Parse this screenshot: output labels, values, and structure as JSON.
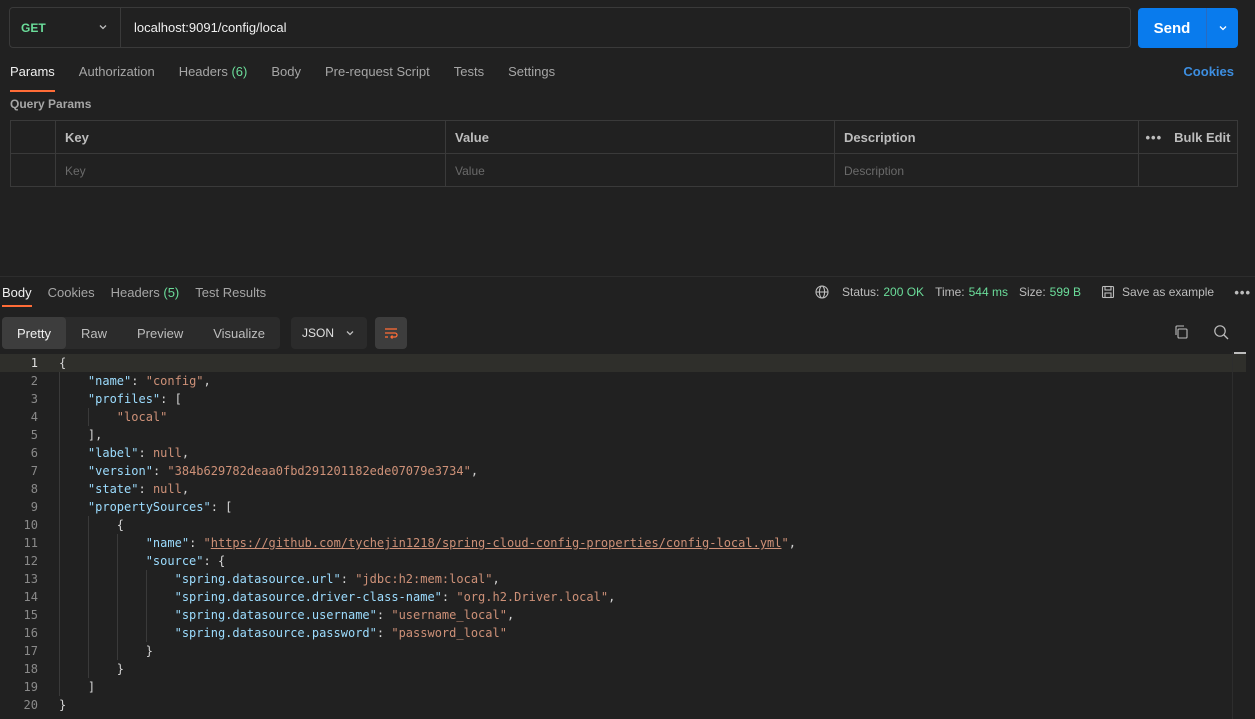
{
  "request": {
    "method": "GET",
    "url": "localhost:9091/config/local",
    "send_label": "Send"
  },
  "request_tabs": [
    {
      "label": "Params",
      "count": ""
    },
    {
      "label": "Authorization",
      "count": ""
    },
    {
      "label": "Headers",
      "count": "(6)"
    },
    {
      "label": "Body",
      "count": ""
    },
    {
      "label": "Pre-request Script",
      "count": ""
    },
    {
      "label": "Tests",
      "count": ""
    },
    {
      "label": "Settings",
      "count": ""
    }
  ],
  "cookies_link": "Cookies",
  "query_params": {
    "title": "Query Params",
    "headers": {
      "key": "Key",
      "value": "Value",
      "description": "Description",
      "bulk_edit": "Bulk Edit"
    },
    "placeholders": {
      "key": "Key",
      "value": "Value",
      "description": "Description"
    }
  },
  "response_tabs": [
    {
      "label": "Body",
      "count": ""
    },
    {
      "label": "Cookies",
      "count": ""
    },
    {
      "label": "Headers",
      "count": "(5)"
    },
    {
      "label": "Test Results",
      "count": ""
    }
  ],
  "response_status": {
    "status_label": "Status:",
    "status_value": "200 OK",
    "time_label": "Time:",
    "time_value": "544 ms",
    "size_label": "Size:",
    "size_value": "599 B",
    "save_example": "Save as example"
  },
  "format_tabs": [
    "Pretty",
    "Raw",
    "Preview",
    "Visualize"
  ],
  "format_select": "JSON",
  "colors": {
    "accent": "#ff6c37",
    "send": "#097bed",
    "success": "#6bdd9a",
    "link": "#3d8ee0"
  },
  "code_lines": [
    [
      [
        "p",
        "{"
      ]
    ],
    [
      [
        "p",
        "    "
      ],
      [
        "k",
        "\"name\""
      ],
      [
        "p",
        ": "
      ],
      [
        "s",
        "\"config\""
      ],
      [
        "p",
        ","
      ]
    ],
    [
      [
        "p",
        "    "
      ],
      [
        "k",
        "\"profiles\""
      ],
      [
        "p",
        ": ["
      ]
    ],
    [
      [
        "p",
        "        "
      ],
      [
        "s",
        "\"local\""
      ]
    ],
    [
      [
        "p",
        "    ],"
      ]
    ],
    [
      [
        "p",
        "    "
      ],
      [
        "k",
        "\"label\""
      ],
      [
        "p",
        ": "
      ],
      [
        "n",
        "null"
      ],
      [
        "p",
        ","
      ]
    ],
    [
      [
        "p",
        "    "
      ],
      [
        "k",
        "\"version\""
      ],
      [
        "p",
        ": "
      ],
      [
        "s",
        "\"384b629782deaa0fbd291201182ede07079e3734\""
      ],
      [
        "p",
        ","
      ]
    ],
    [
      [
        "p",
        "    "
      ],
      [
        "k",
        "\"state\""
      ],
      [
        "p",
        ": "
      ],
      [
        "n",
        "null"
      ],
      [
        "p",
        ","
      ]
    ],
    [
      [
        "p",
        "    "
      ],
      [
        "k",
        "\"propertySources\""
      ],
      [
        "p",
        ": ["
      ]
    ],
    [
      [
        "p",
        "        {"
      ]
    ],
    [
      [
        "p",
        "            "
      ],
      [
        "k",
        "\"name\""
      ],
      [
        "p",
        ": "
      ],
      [
        "s",
        "\""
      ],
      [
        "u",
        "https://github.com/tychejin1218/spring-cloud-config-properties/config-local.yml"
      ],
      [
        "s",
        "\""
      ],
      [
        "p",
        ","
      ]
    ],
    [
      [
        "p",
        "            "
      ],
      [
        "k",
        "\"source\""
      ],
      [
        "p",
        ": {"
      ]
    ],
    [
      [
        "p",
        "                "
      ],
      [
        "k",
        "\"spring.datasource.url\""
      ],
      [
        "p",
        ": "
      ],
      [
        "s",
        "\"jdbc:h2:mem:local\""
      ],
      [
        "p",
        ","
      ]
    ],
    [
      [
        "p",
        "                "
      ],
      [
        "k",
        "\"spring.datasource.driver-class-name\""
      ],
      [
        "p",
        ": "
      ],
      [
        "s",
        "\"org.h2.Driver.local\""
      ],
      [
        "p",
        ","
      ]
    ],
    [
      [
        "p",
        "                "
      ],
      [
        "k",
        "\"spring.datasource.username\""
      ],
      [
        "p",
        ": "
      ],
      [
        "s",
        "\"username_local\""
      ],
      [
        "p",
        ","
      ]
    ],
    [
      [
        "p",
        "                "
      ],
      [
        "k",
        "\"spring.datasource.password\""
      ],
      [
        "p",
        ": "
      ],
      [
        "s",
        "\"password_local\""
      ]
    ],
    [
      [
        "p",
        "            }"
      ]
    ],
    [
      [
        "p",
        "        }"
      ]
    ],
    [
      [
        "p",
        "    ]"
      ]
    ],
    [
      [
        "p",
        "}"
      ]
    ]
  ]
}
